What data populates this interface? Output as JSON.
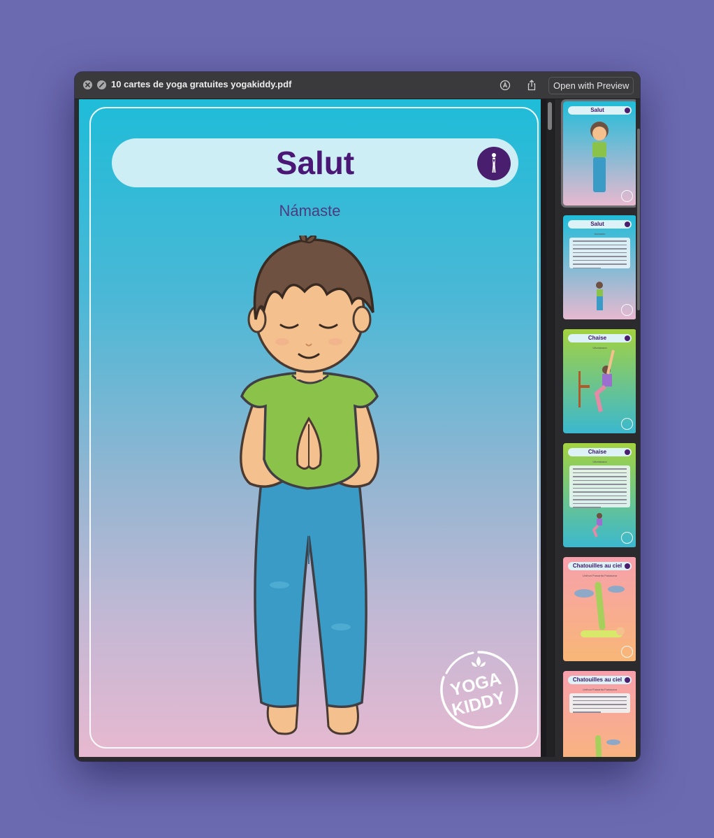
{
  "window": {
    "title": "10 cartes de yoga gratuites yogakiddy.pdf",
    "open_button_label": "Open with Preview"
  },
  "card": {
    "title": "Salut",
    "subtitle": "Námaste",
    "logo_text_top": "YOGA",
    "logo_text_bottom": "KIDDY"
  },
  "thumbnails": [
    {
      "title": "Salut",
      "kind": "illustration",
      "gradient": [
        "#1fbcd8",
        "#e7b9d0"
      ]
    },
    {
      "title": "Salut",
      "kind": "text",
      "subtitle": "Námaste",
      "gradient": [
        "#1fbcd8",
        "#e7b9d0"
      ]
    },
    {
      "title": "Chaise",
      "kind": "illustration",
      "subtitle": "Utkatasana",
      "gradient": [
        "#a4d23f",
        "#3bb8cf"
      ]
    },
    {
      "title": "Chaise",
      "kind": "text",
      "subtitle": "Utkatasana",
      "gradient": [
        "#a4d23f",
        "#3bb8cf"
      ]
    },
    {
      "title": "Chatouilles au ciel",
      "kind": "illustration",
      "subtitle": "Urdhva Prasarita Padasana",
      "gradient": [
        "#f7a0ad",
        "#f8b777"
      ]
    },
    {
      "title": "Chatouilles au ciel",
      "kind": "text",
      "subtitle": "Urdhva Prasarita Padasana",
      "gradient": [
        "#f7a0ad",
        "#f8b777"
      ]
    }
  ],
  "colors": {
    "desktop": "#6b69b0",
    "title_purple": "#4a1776",
    "badge_purple": "#4a1e6e",
    "card_top": "#1fbcd8",
    "card_bottom": "#e7b9d0"
  },
  "icons": {
    "close": "close-icon",
    "minimize": "minimize-icon",
    "markup": "markup-icon",
    "share": "share-icon",
    "pose": "standing-pose-icon",
    "logo": "yogakiddy-logo"
  }
}
